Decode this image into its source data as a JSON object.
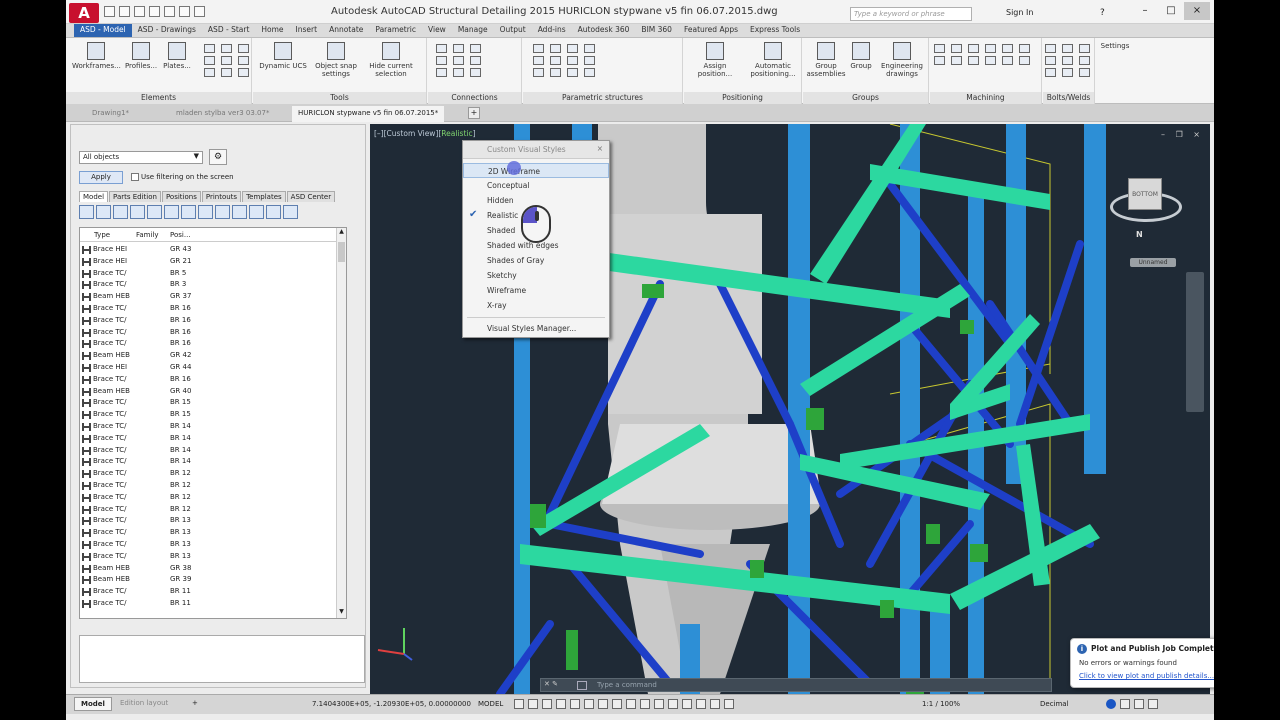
{
  "titlebar": {
    "title": "Autodesk AutoCAD Structural Detailing 2015      HURICLON stypwane v5  fin 06.07.2015.dwg",
    "search_placeholder": "Type a keyword or phrase",
    "signin": "Sign In",
    "help": "?",
    "minimize": "–",
    "maximize": "□",
    "close": "×"
  },
  "ribbon": {
    "tabs": [
      "ASD - Model",
      "ASD - Drawings",
      "ASD - Start",
      "Home",
      "Insert",
      "Annotate",
      "Parametric",
      "View",
      "Manage",
      "Output",
      "Add-ins",
      "Autodesk 360",
      "BIM 360",
      "Featured Apps",
      "Express Tools"
    ],
    "groups": {
      "elements": {
        "title": "Elements",
        "buttons": [
          "Workframes...",
          "Profiles...",
          "Plates..."
        ]
      },
      "tools": {
        "title": "Tools",
        "buttons": [
          "Dynamic UCS",
          "Object snap settings",
          "Hide current selection"
        ]
      },
      "connections": {
        "title": "Connections"
      },
      "parametric": {
        "title": "Parametric structures"
      },
      "positioning": {
        "title": "Positioning",
        "buttons": [
          "Assign position...",
          "Automatic positioning..."
        ]
      },
      "groups": {
        "title": "Groups",
        "buttons": [
          "Group assemblies",
          "Group",
          "Engineering drawings"
        ]
      },
      "machining": {
        "title": "Machining"
      },
      "bolts": {
        "title": "Bolts/Welds"
      },
      "settings": {
        "title": "Settings"
      }
    }
  },
  "doc_tabs": [
    "Drawing1*",
    "mladen stylba ver3 03.07*",
    "HURICLON stypwane v5  fin 06.07.2015*"
  ],
  "doc_tab_add": "+",
  "palette": {
    "filter_value": "All objects",
    "apply": "Apply",
    "use_filter": "Use filtering on the screen",
    "tabs": [
      "Model",
      "Parts Edition",
      "Positions",
      "Printouts",
      "Templates",
      "ASD Center"
    ],
    "columns": [
      "Type",
      "Family",
      "Posi..."
    ],
    "rows": [
      {
        "type": "Brace HEI",
        "pos": "GR 43"
      },
      {
        "type": "Brace HEI",
        "pos": "GR 21"
      },
      {
        "type": "Brace TC/",
        "pos": "BR 5"
      },
      {
        "type": "Brace TC/",
        "pos": "BR 3"
      },
      {
        "type": "Beam HEB",
        "pos": "GR 37"
      },
      {
        "type": "Brace TC/",
        "pos": "BR 16"
      },
      {
        "type": "Brace TC/",
        "pos": "BR 16"
      },
      {
        "type": "Brace TC/",
        "pos": "BR 16"
      },
      {
        "type": "Brace TC/",
        "pos": "BR 16"
      },
      {
        "type": "Beam HEB",
        "pos": "GR 42"
      },
      {
        "type": "Brace HEI",
        "pos": "GR 44"
      },
      {
        "type": "Brace TC/",
        "pos": "BR 16"
      },
      {
        "type": "Beam HEB",
        "pos": "GR 40"
      },
      {
        "type": "Brace TC/",
        "pos": "BR 15"
      },
      {
        "type": "Brace TC/",
        "pos": "BR 15"
      },
      {
        "type": "Brace TC/",
        "pos": "BR 14"
      },
      {
        "type": "Brace TC/",
        "pos": "BR 14"
      },
      {
        "type": "Brace TC/",
        "pos": "BR 14"
      },
      {
        "type": "Brace TC/",
        "pos": "BR 14"
      },
      {
        "type": "Brace TC/",
        "pos": "BR 12"
      },
      {
        "type": "Brace TC/",
        "pos": "BR 12"
      },
      {
        "type": "Brace TC/",
        "pos": "BR 12"
      },
      {
        "type": "Brace TC/",
        "pos": "BR 12"
      },
      {
        "type": "Brace TC/",
        "pos": "BR 13"
      },
      {
        "type": "Brace TC/",
        "pos": "BR 13"
      },
      {
        "type": "Brace TC/",
        "pos": "BR 13"
      },
      {
        "type": "Brace TC/",
        "pos": "BR 13"
      },
      {
        "type": "Beam HEB",
        "pos": "GR 38"
      },
      {
        "type": "Beam HEB",
        "pos": "GR 39"
      },
      {
        "type": "Brace TC/",
        "pos": "BR 11"
      },
      {
        "type": "Brace TC/",
        "pos": "BR 11"
      }
    ]
  },
  "viewport": {
    "label_prefix": "[–][Custom View][",
    "label_style": "Realistic",
    "label_suffix": "]",
    "viewcube_face": "BOTTOM",
    "compass_dir": "N",
    "wcs": "Unnamed",
    "command_placeholder": "Type a command",
    "command_ctrl": "✕ ✎",
    "window_controls": "– ❐ ×"
  },
  "visual_styles_menu": {
    "header": "Custom Visual Styles",
    "close": "×",
    "items": [
      "2D Wireframe",
      "Conceptual",
      "Hidden",
      "Realistic",
      "Shaded",
      "Shaded with edges",
      "Shades of Gray",
      "Sketchy",
      "Wireframe",
      "X-ray"
    ],
    "checked_item": "Realistic",
    "highlighted_item": "2D Wireframe",
    "manager": "Visual Styles Manager..."
  },
  "notification": {
    "title": "Plot and Publish Job Complete",
    "message": "No errors or warnings found",
    "link": "Click to view plot and publish details...",
    "close": "×"
  },
  "statusbar": {
    "layout_model": "Model",
    "layout_edition": "Edition layout",
    "add": "+",
    "coords": "7.1404300E+05, -1.20930E+05, 0.00000000",
    "mode": "MODEL",
    "scale": "1:1 / 100%",
    "units": "Decimal"
  },
  "colors": {
    "viewport_bg": "#1f2a36",
    "column_blue": "#2d8fd6",
    "beam_teal": "#2cd8a0",
    "brace_blue": "#1e3fc8",
    "connection_green": "#2ea53a",
    "silo_gray": "#c9c9c9",
    "accent": "#2d64b1"
  }
}
